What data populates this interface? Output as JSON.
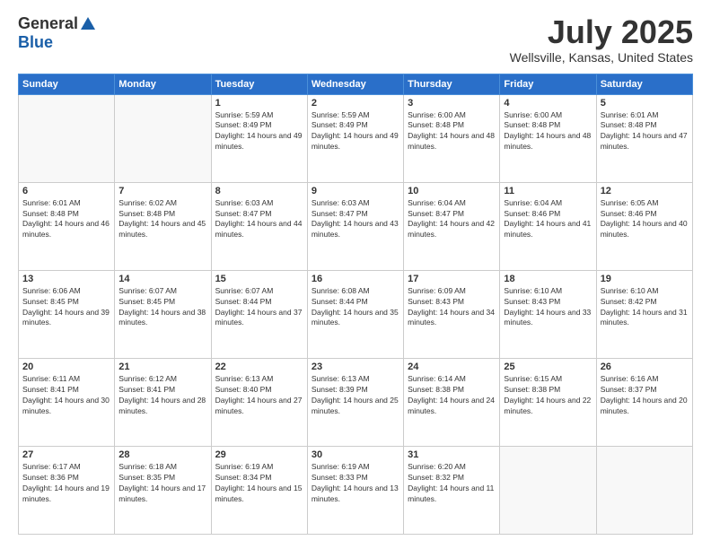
{
  "logo": {
    "general": "General",
    "blue": "Blue"
  },
  "header": {
    "month": "July 2025",
    "location": "Wellsville, Kansas, United States"
  },
  "weekdays": [
    "Sunday",
    "Monday",
    "Tuesday",
    "Wednesday",
    "Thursday",
    "Friday",
    "Saturday"
  ],
  "weeks": [
    [
      {
        "day": "",
        "sunrise": "",
        "sunset": "",
        "daylight": ""
      },
      {
        "day": "",
        "sunrise": "",
        "sunset": "",
        "daylight": ""
      },
      {
        "day": "1",
        "sunrise": "Sunrise: 5:59 AM",
        "sunset": "Sunset: 8:49 PM",
        "daylight": "Daylight: 14 hours and 49 minutes."
      },
      {
        "day": "2",
        "sunrise": "Sunrise: 5:59 AM",
        "sunset": "Sunset: 8:49 PM",
        "daylight": "Daylight: 14 hours and 49 minutes."
      },
      {
        "day": "3",
        "sunrise": "Sunrise: 6:00 AM",
        "sunset": "Sunset: 8:48 PM",
        "daylight": "Daylight: 14 hours and 48 minutes."
      },
      {
        "day": "4",
        "sunrise": "Sunrise: 6:00 AM",
        "sunset": "Sunset: 8:48 PM",
        "daylight": "Daylight: 14 hours and 48 minutes."
      },
      {
        "day": "5",
        "sunrise": "Sunrise: 6:01 AM",
        "sunset": "Sunset: 8:48 PM",
        "daylight": "Daylight: 14 hours and 47 minutes."
      }
    ],
    [
      {
        "day": "6",
        "sunrise": "Sunrise: 6:01 AM",
        "sunset": "Sunset: 8:48 PM",
        "daylight": "Daylight: 14 hours and 46 minutes."
      },
      {
        "day": "7",
        "sunrise": "Sunrise: 6:02 AM",
        "sunset": "Sunset: 8:48 PM",
        "daylight": "Daylight: 14 hours and 45 minutes."
      },
      {
        "day": "8",
        "sunrise": "Sunrise: 6:03 AM",
        "sunset": "Sunset: 8:47 PM",
        "daylight": "Daylight: 14 hours and 44 minutes."
      },
      {
        "day": "9",
        "sunrise": "Sunrise: 6:03 AM",
        "sunset": "Sunset: 8:47 PM",
        "daylight": "Daylight: 14 hours and 43 minutes."
      },
      {
        "day": "10",
        "sunrise": "Sunrise: 6:04 AM",
        "sunset": "Sunset: 8:47 PM",
        "daylight": "Daylight: 14 hours and 42 minutes."
      },
      {
        "day": "11",
        "sunrise": "Sunrise: 6:04 AM",
        "sunset": "Sunset: 8:46 PM",
        "daylight": "Daylight: 14 hours and 41 minutes."
      },
      {
        "day": "12",
        "sunrise": "Sunrise: 6:05 AM",
        "sunset": "Sunset: 8:46 PM",
        "daylight": "Daylight: 14 hours and 40 minutes."
      }
    ],
    [
      {
        "day": "13",
        "sunrise": "Sunrise: 6:06 AM",
        "sunset": "Sunset: 8:45 PM",
        "daylight": "Daylight: 14 hours and 39 minutes."
      },
      {
        "day": "14",
        "sunrise": "Sunrise: 6:07 AM",
        "sunset": "Sunset: 8:45 PM",
        "daylight": "Daylight: 14 hours and 38 minutes."
      },
      {
        "day": "15",
        "sunrise": "Sunrise: 6:07 AM",
        "sunset": "Sunset: 8:44 PM",
        "daylight": "Daylight: 14 hours and 37 minutes."
      },
      {
        "day": "16",
        "sunrise": "Sunrise: 6:08 AM",
        "sunset": "Sunset: 8:44 PM",
        "daylight": "Daylight: 14 hours and 35 minutes."
      },
      {
        "day": "17",
        "sunrise": "Sunrise: 6:09 AM",
        "sunset": "Sunset: 8:43 PM",
        "daylight": "Daylight: 14 hours and 34 minutes."
      },
      {
        "day": "18",
        "sunrise": "Sunrise: 6:10 AM",
        "sunset": "Sunset: 8:43 PM",
        "daylight": "Daylight: 14 hours and 33 minutes."
      },
      {
        "day": "19",
        "sunrise": "Sunrise: 6:10 AM",
        "sunset": "Sunset: 8:42 PM",
        "daylight": "Daylight: 14 hours and 31 minutes."
      }
    ],
    [
      {
        "day": "20",
        "sunrise": "Sunrise: 6:11 AM",
        "sunset": "Sunset: 8:41 PM",
        "daylight": "Daylight: 14 hours and 30 minutes."
      },
      {
        "day": "21",
        "sunrise": "Sunrise: 6:12 AM",
        "sunset": "Sunset: 8:41 PM",
        "daylight": "Daylight: 14 hours and 28 minutes."
      },
      {
        "day": "22",
        "sunrise": "Sunrise: 6:13 AM",
        "sunset": "Sunset: 8:40 PM",
        "daylight": "Daylight: 14 hours and 27 minutes."
      },
      {
        "day": "23",
        "sunrise": "Sunrise: 6:13 AM",
        "sunset": "Sunset: 8:39 PM",
        "daylight": "Daylight: 14 hours and 25 minutes."
      },
      {
        "day": "24",
        "sunrise": "Sunrise: 6:14 AM",
        "sunset": "Sunset: 8:38 PM",
        "daylight": "Daylight: 14 hours and 24 minutes."
      },
      {
        "day": "25",
        "sunrise": "Sunrise: 6:15 AM",
        "sunset": "Sunset: 8:38 PM",
        "daylight": "Daylight: 14 hours and 22 minutes."
      },
      {
        "day": "26",
        "sunrise": "Sunrise: 6:16 AM",
        "sunset": "Sunset: 8:37 PM",
        "daylight": "Daylight: 14 hours and 20 minutes."
      }
    ],
    [
      {
        "day": "27",
        "sunrise": "Sunrise: 6:17 AM",
        "sunset": "Sunset: 8:36 PM",
        "daylight": "Daylight: 14 hours and 19 minutes."
      },
      {
        "day": "28",
        "sunrise": "Sunrise: 6:18 AM",
        "sunset": "Sunset: 8:35 PM",
        "daylight": "Daylight: 14 hours and 17 minutes."
      },
      {
        "day": "29",
        "sunrise": "Sunrise: 6:19 AM",
        "sunset": "Sunset: 8:34 PM",
        "daylight": "Daylight: 14 hours and 15 minutes."
      },
      {
        "day": "30",
        "sunrise": "Sunrise: 6:19 AM",
        "sunset": "Sunset: 8:33 PM",
        "daylight": "Daylight: 14 hours and 13 minutes."
      },
      {
        "day": "31",
        "sunrise": "Sunrise: 6:20 AM",
        "sunset": "Sunset: 8:32 PM",
        "daylight": "Daylight: 14 hours and 11 minutes."
      },
      {
        "day": "",
        "sunrise": "",
        "sunset": "",
        "daylight": ""
      },
      {
        "day": "",
        "sunrise": "",
        "sunset": "",
        "daylight": ""
      }
    ]
  ]
}
